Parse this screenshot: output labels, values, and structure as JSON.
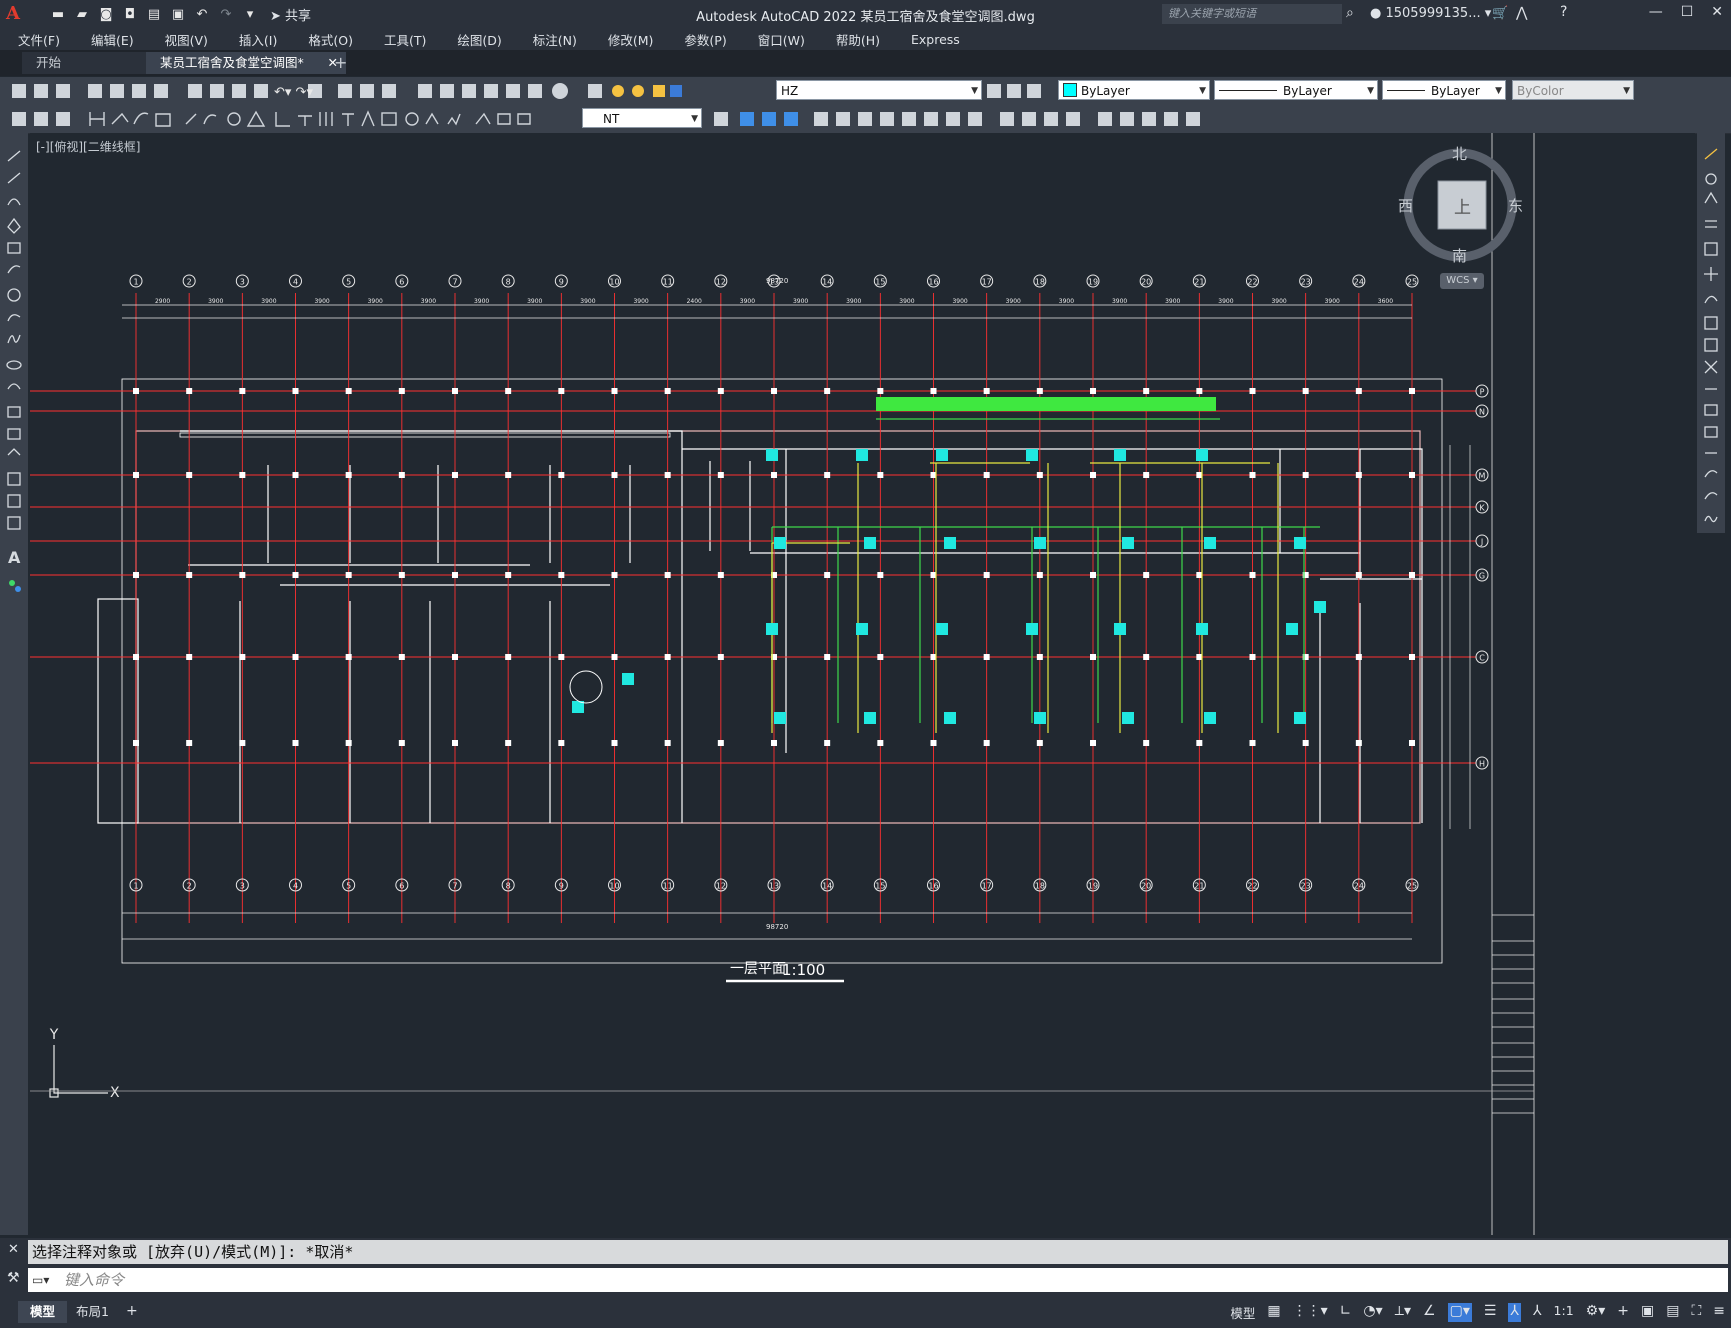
{
  "app": {
    "logo": "A",
    "window_title": "Autodesk AutoCAD 2022    某员工宿舍及食堂空调图.dwg",
    "share_label": "共享",
    "search_placeholder": "键入关键字或短语",
    "user": "1505999135...",
    "accent": "#e23b2e"
  },
  "menu": [
    "文件(F)",
    "编辑(E)",
    "视图(V)",
    "插入(I)",
    "格式(O)",
    "工具(T)",
    "绘图(D)",
    "标注(N)",
    "修改(M)",
    "参数(P)",
    "窗口(W)",
    "帮助(H)",
    "Express"
  ],
  "file_tabs": [
    {
      "label": "开始",
      "active": false
    },
    {
      "label": "某员工宿舍及食堂空调图*",
      "active": true
    }
  ],
  "toolbar": {
    "layer": "HZ",
    "color": "ByLayer",
    "linetype": "ByLayer",
    "lineweight": "ByLayer",
    "plotstyle": "ByColor",
    "textstyle": "NT"
  },
  "viewport": {
    "label": "[-][俯视][二维线框]",
    "viewcube": {
      "top": "上",
      "north": "北",
      "south": "南",
      "east": "东",
      "west": "西",
      "wcs": "WCS"
    },
    "ucs": {
      "x": "X",
      "y": "Y"
    },
    "drawing_title": "一层平面",
    "drawing_scale": "1:100",
    "grid_top": [
      "1",
      "2",
      "3",
      "4",
      "5",
      "6",
      "7",
      "8",
      "9",
      "10",
      "11",
      "12",
      "13",
      "14",
      "15",
      "16",
      "17",
      "18",
      "19",
      "20",
      "21",
      "22",
      "23",
      "24",
      "25"
    ],
    "grid_right": [
      "P",
      "N",
      "M",
      "K",
      "J",
      "G",
      "C",
      "H"
    ],
    "dims_top": [
      "2900",
      "3900",
      "3900",
      "3900",
      "3900",
      "3900",
      "3900",
      "3900",
      "3900",
      "3900",
      "2400",
      "3900",
      "3900",
      "3900",
      "3900",
      "3900",
      "3900",
      "3900",
      "3900",
      "3900",
      "3900",
      "3900",
      "3900",
      "3600"
    ],
    "total_dim": "98720"
  },
  "command": {
    "history": "选择注释对象或 [放弃(U)/模式(M)]: *取消*",
    "placeholder": "键入命令"
  },
  "layout_tabs": [
    {
      "label": "模型",
      "active": true
    },
    {
      "label": "布局1",
      "active": false
    }
  ],
  "status": {
    "model_label": "模型",
    "scale": "1:1"
  }
}
